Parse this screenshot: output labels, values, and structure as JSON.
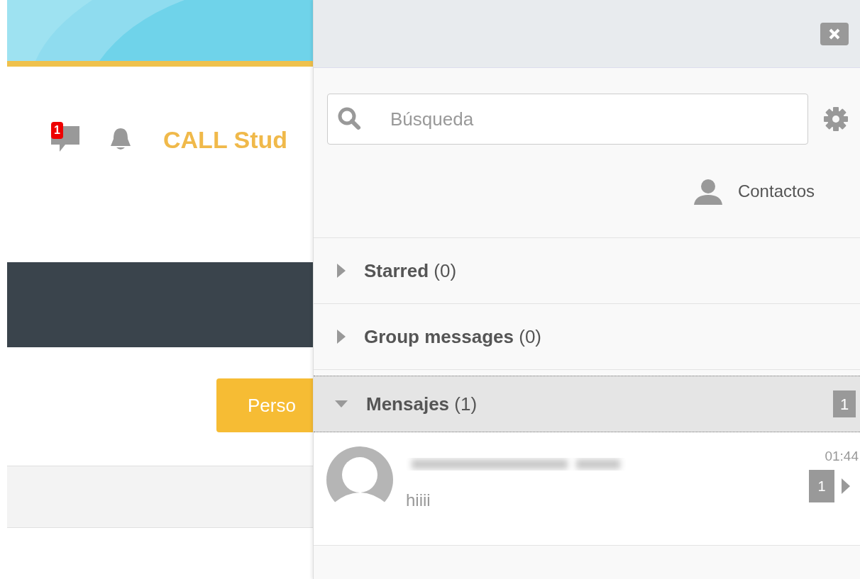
{
  "header": {
    "notification_count": "1",
    "site_title": "CALL Stud",
    "button": "Perso"
  },
  "drawer": {
    "search": {
      "placeholder": "Búsqueda"
    },
    "contacts_link": "Contactos",
    "sections": [
      {
        "title": "Starred",
        "count": "(0)",
        "expanded": false,
        "selected": false
      },
      {
        "title": "Group messages",
        "count": "(0)",
        "expanded": false,
        "selected": false
      },
      {
        "title": "Mensajes",
        "count": "(1)",
        "expanded": true,
        "selected": true,
        "badge": "1",
        "messages": [
          {
            "text": "hiiii",
            "time": "01:44",
            "unread": "1"
          }
        ]
      }
    ]
  }
}
